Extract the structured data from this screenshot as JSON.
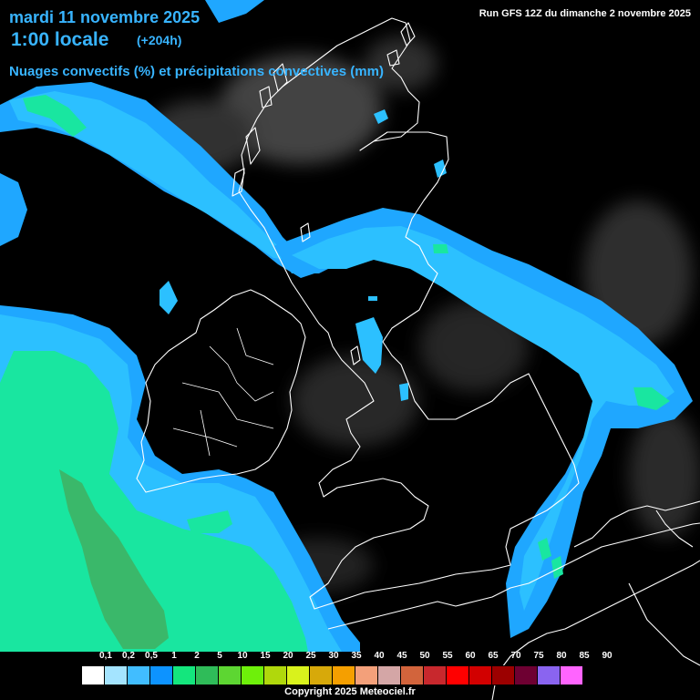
{
  "header": {
    "date": "mardi 11 novembre 2025",
    "hour": "1:00 locale",
    "lead": "(+204h)",
    "subtitle": "Nuages convectifs (%) et précipitations convectives (mm)",
    "run": "Run GFS 12Z du dimanche 2 novembre 2025"
  },
  "legend": {
    "labels": [
      "0,1",
      "0,2",
      "0,5",
      "1",
      "2",
      "5",
      "10",
      "15",
      "20",
      "25",
      "30",
      "35",
      "40",
      "45",
      "50",
      "55",
      "60",
      "65",
      "70",
      "75",
      "80",
      "85",
      "90"
    ],
    "colors": [
      "#ffffff",
      "#a4e4ff",
      "#41bdff",
      "#0d93ff",
      "#14e67d",
      "#2fbc59",
      "#5dd632",
      "#6ef00a",
      "#b0d80c",
      "#d9f21c",
      "#d7a90a",
      "#f59f00",
      "#f3a07a",
      "#d4a6a6",
      "#d2643c",
      "#c8282d",
      "#ff0000",
      "#d20000",
      "#9c0000",
      "#6e0032",
      "#8a64f0",
      "#ff64ff"
    ]
  },
  "colors": {
    "cloud_light": "#33c9ff",
    "cloud_medium": "#1fb8ff",
    "precip_green": "#19e6a0",
    "precip_dark": "#3ab86a",
    "title": "#38b4ff"
  },
  "copyright": "Copyright 2025 Meteociel.fr"
}
